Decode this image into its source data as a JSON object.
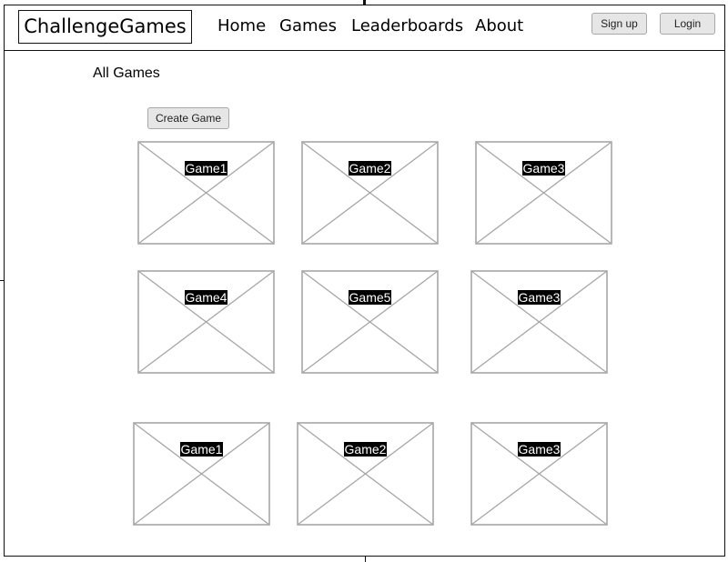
{
  "header": {
    "logo": "ChallengeGames",
    "nav": [
      "Home",
      "Games",
      "Leaderboards",
      "About"
    ],
    "signup_label": "Sign up",
    "login_label": "Login"
  },
  "main": {
    "heading": "All Games",
    "create_label": "Create Game",
    "games": [
      {
        "name": "Game1"
      },
      {
        "name": "Game2"
      },
      {
        "name": "Game3"
      },
      {
        "name": "Game4"
      },
      {
        "name": "Game5"
      },
      {
        "name": "Game3"
      },
      {
        "name": "Game1"
      },
      {
        "name": "Game2"
      },
      {
        "name": "Game3"
      }
    ]
  }
}
